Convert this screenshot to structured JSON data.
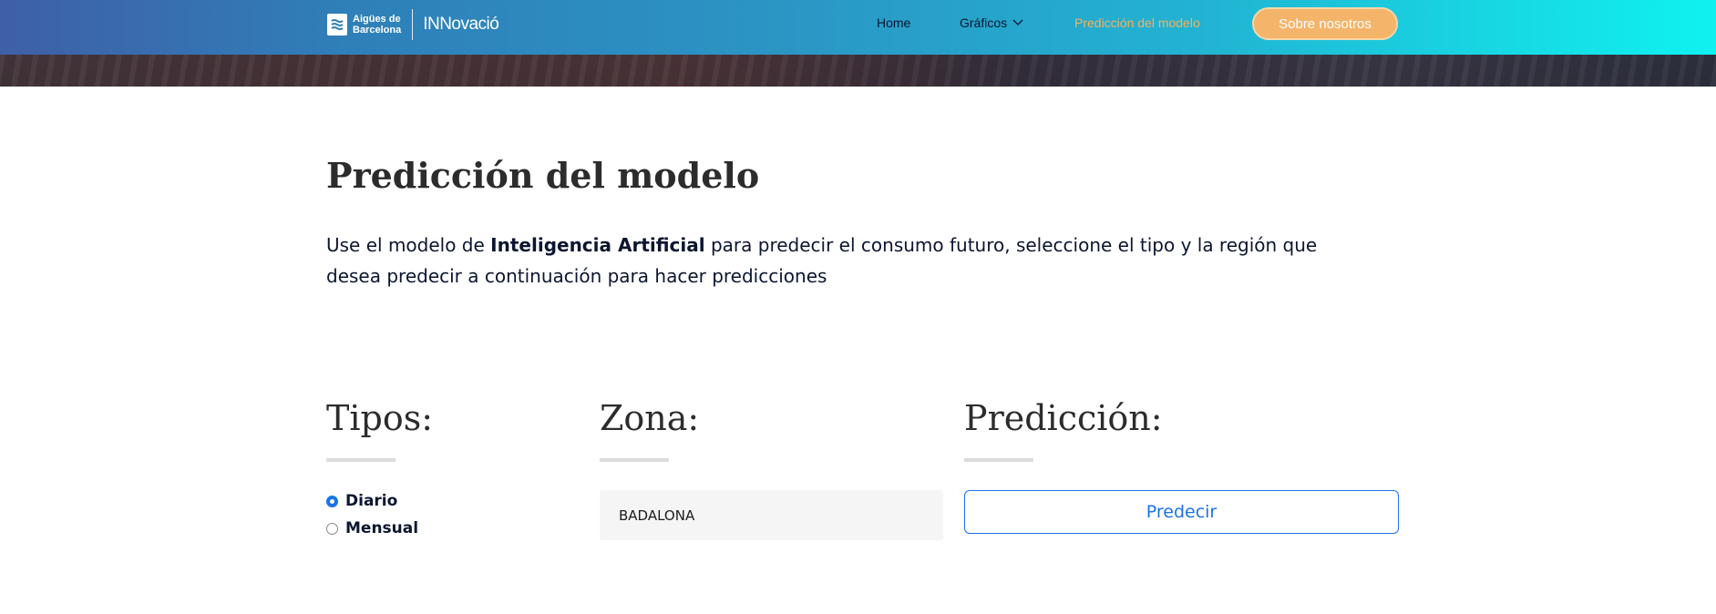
{
  "brand": {
    "logo_line1": "Aigües de",
    "logo_line2": "Barcelona",
    "innovacio": "INNovació"
  },
  "nav": {
    "home": "Home",
    "graficos": "Gráficos",
    "prediccion": "Predicción del modelo",
    "sobre": "Sobre nosotros"
  },
  "main": {
    "title": "Predicción del modelo",
    "intro_pre": "Use el modelo de ",
    "intro_bold": "Inteligencia Artificial",
    "intro_post": " para predecir el consumo futuro, seleccione el tipo y la región que desea predecir a continuación para hacer predicciones"
  },
  "tipos": {
    "heading": "Tipos:",
    "options": [
      {
        "label": "Diario",
        "checked": true
      },
      {
        "label": "Mensual",
        "checked": false
      }
    ]
  },
  "zona": {
    "heading": "Zona:",
    "selected": "BADALONA"
  },
  "prediccion": {
    "heading": "Predicción:",
    "button": "Predecir"
  },
  "colors": {
    "accent_blue": "#1a73e8",
    "nav_active": "#f5b25f",
    "cta_orange": "#f4b46a"
  }
}
